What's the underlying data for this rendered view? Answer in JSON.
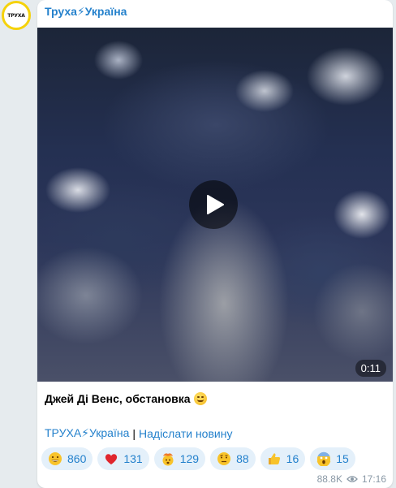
{
  "channel": {
    "name": "Труха⚡Україна",
    "avatar_text": "ТРУХА",
    "brand_color": "#2481cc",
    "avatar_ring_color": "#f5d20b"
  },
  "video": {
    "duration": "0:11",
    "play_icon": "play-icon"
  },
  "post": {
    "caption": "Джей Ді Венс, обстановка",
    "caption_emoji": "grinning-face-icon",
    "link_channel": "ТРУХА⚡Україна",
    "link_separator": "|",
    "link_submit": "Надіслати новину"
  },
  "reactions": [
    {
      "icon": "grinning-face-icon",
      "count": "860"
    },
    {
      "icon": "red-heart-icon",
      "count": "131"
    },
    {
      "icon": "exploding-head-icon",
      "count": "129"
    },
    {
      "icon": "raised-eyebrow-face-icon",
      "count": "88"
    },
    {
      "icon": "thumbs-up-icon",
      "count": "16"
    },
    {
      "icon": "screaming-face-icon",
      "count": "15"
    }
  ],
  "meta": {
    "views": "88.8K",
    "view_icon": "eye-icon",
    "time": "17:16"
  }
}
